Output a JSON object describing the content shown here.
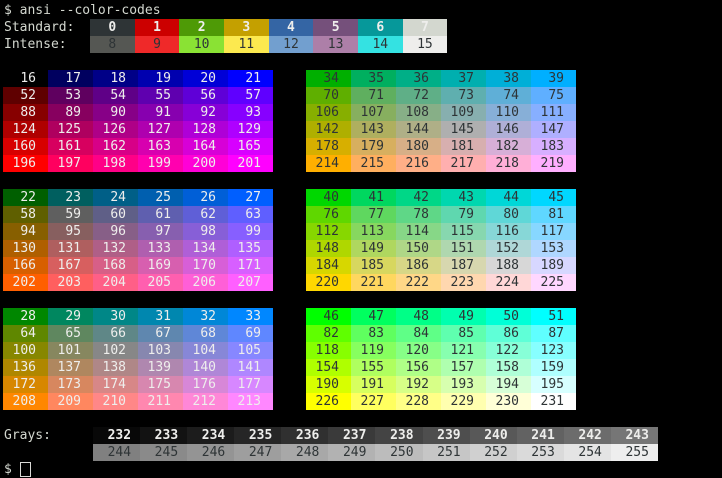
{
  "terminal": {
    "bg": "#000000",
    "fg": "#d3d7cf",
    "command_line": "$ ansi --color-codes",
    "prompt": "$",
    "cursor_color": "#d9d9d6",
    "cursor_style": "hollow-block"
  },
  "standard": {
    "label": "Standard:",
    "fg": "#eeeeec",
    "cells": [
      {
        "n": "0",
        "bg": "#2e3436"
      },
      {
        "n": "1",
        "bg": "#cc0000"
      },
      {
        "n": "2",
        "bg": "#4e9a06"
      },
      {
        "n": "3",
        "bg": "#c4a000"
      },
      {
        "n": "4",
        "bg": "#3465a4"
      },
      {
        "n": "5",
        "bg": "#75507b"
      },
      {
        "n": "6",
        "bg": "#06989a"
      },
      {
        "n": "7",
        "bg": "#d3d7cf"
      }
    ]
  },
  "intense": {
    "label": "Intense:",
    "fg": "#2e3436",
    "cells": [
      {
        "n": "8",
        "bg": "#555753"
      },
      {
        "n": "9",
        "bg": "#ef2929"
      },
      {
        "n": "10",
        "bg": "#8ae234"
      },
      {
        "n": "11",
        "bg": "#fce94f"
      },
      {
        "n": "12",
        "bg": "#729fcf"
      },
      {
        "n": "13",
        "bg": "#ad7fa8"
      },
      {
        "n": "14",
        "bg": "#34e2e2"
      },
      {
        "n": "15",
        "bg": "#eeeeec"
      }
    ]
  },
  "cube": {
    "blocks": [
      {
        "id": "block-l1",
        "name": "color-cube-block-1-left",
        "fg": "#eeeeec",
        "rows": [
          {
            "numbers": [
              "16",
              "17",
              "18",
              "19",
              "20",
              "21"
            ],
            "colors": [
              "#000000",
              "#00005f",
              "#000087",
              "#0000af",
              "#0000d7",
              "#0000ff"
            ]
          },
          {
            "numbers": [
              "52",
              "53",
              "54",
              "55",
              "56",
              "57"
            ],
            "colors": [
              "#5f0000",
              "#5f005f",
              "#5f0087",
              "#5f00af",
              "#5f00d7",
              "#5f00ff"
            ]
          },
          {
            "numbers": [
              "88",
              "89",
              "90",
              "91",
              "92",
              "93"
            ],
            "colors": [
              "#870000",
              "#87005f",
              "#870087",
              "#8700af",
              "#8700d7",
              "#8700ff"
            ]
          },
          {
            "numbers": [
              "124",
              "125",
              "126",
              "127",
              "128",
              "129"
            ],
            "colors": [
              "#af0000",
              "#af005f",
              "#af0087",
              "#af00af",
              "#af00d7",
              "#af00ff"
            ]
          },
          {
            "numbers": [
              "160",
              "161",
              "162",
              "163",
              "164",
              "165"
            ],
            "colors": [
              "#d70000",
              "#d7005f",
              "#d70087",
              "#d700af",
              "#d700d7",
              "#d700ff"
            ]
          },
          {
            "numbers": [
              "196",
              "197",
              "198",
              "199",
              "200",
              "201"
            ],
            "colors": [
              "#ff0000",
              "#ff005f",
              "#ff0087",
              "#ff00af",
              "#ff00d7",
              "#ff00ff"
            ]
          }
        ]
      },
      {
        "id": "block-r1",
        "name": "color-cube-block-1-right",
        "fg": "#2e3436",
        "rows": [
          {
            "numbers": [
              "34",
              "35",
              "36",
              "37",
              "38",
              "39"
            ],
            "colors": [
              "#00af00",
              "#00af5f",
              "#00af87",
              "#00afaf",
              "#00afd7",
              "#00afff"
            ]
          },
          {
            "numbers": [
              "70",
              "71",
              "72",
              "73",
              "74",
              "75"
            ],
            "colors": [
              "#5faf00",
              "#5faf5f",
              "#5faf87",
              "#5fafaf",
              "#5fafd7",
              "#5fafff"
            ]
          },
          {
            "numbers": [
              "106",
              "107",
              "108",
              "109",
              "110",
              "111"
            ],
            "colors": [
              "#87af00",
              "#87af5f",
              "#87af87",
              "#87afaf",
              "#87afd7",
              "#87afff"
            ]
          },
          {
            "numbers": [
              "142",
              "143",
              "144",
              "145",
              "146",
              "147"
            ],
            "colors": [
              "#afaf00",
              "#afaf5f",
              "#afaf87",
              "#afafaf",
              "#afafd7",
              "#afafff"
            ]
          },
          {
            "numbers": [
              "178",
              "179",
              "180",
              "181",
              "182",
              "183"
            ],
            "colors": [
              "#d7af00",
              "#d7af5f",
              "#d7af87",
              "#d7afaf",
              "#d7afd7",
              "#d7afff"
            ]
          },
          {
            "numbers": [
              "214",
              "215",
              "216",
              "217",
              "218",
              "219"
            ],
            "colors": [
              "#ffaf00",
              "#ffaf5f",
              "#ffaf87",
              "#ffafaf",
              "#ffafd7",
              "#ffafff"
            ]
          }
        ]
      },
      {
        "id": "block-l2",
        "name": "color-cube-block-2-left",
        "fg": "#eeeeec",
        "rows": [
          {
            "numbers": [
              "22",
              "23",
              "24",
              "25",
              "26",
              "27"
            ],
            "colors": [
              "#005f00",
              "#005f5f",
              "#005f87",
              "#005faf",
              "#005fd7",
              "#005fff"
            ]
          },
          {
            "numbers": [
              "58",
              "59",
              "60",
              "61",
              "62",
              "63"
            ],
            "colors": [
              "#5f5f00",
              "#5f5f5f",
              "#5f5f87",
              "#5f5faf",
              "#5f5fd7",
              "#5f5fff"
            ]
          },
          {
            "numbers": [
              "94",
              "95",
              "96",
              "97",
              "98",
              "99"
            ],
            "colors": [
              "#875f00",
              "#875f5f",
              "#875f87",
              "#875faf",
              "#875fd7",
              "#875fff"
            ]
          },
          {
            "numbers": [
              "130",
              "131",
              "132",
              "133",
              "134",
              "135"
            ],
            "colors": [
              "#af5f00",
              "#af5f5f",
              "#af5f87",
              "#af5faf",
              "#af5fd7",
              "#af5fff"
            ]
          },
          {
            "numbers": [
              "166",
              "167",
              "168",
              "169",
              "170",
              "171"
            ],
            "colors": [
              "#d75f00",
              "#d75f5f",
              "#d75f87",
              "#d75faf",
              "#d75fd7",
              "#d75fff"
            ]
          },
          {
            "numbers": [
              "202",
              "203",
              "204",
              "205",
              "206",
              "207"
            ],
            "colors": [
              "#ff5f00",
              "#ff5f5f",
              "#ff5f87",
              "#ff5faf",
              "#ff5fd7",
              "#ff5fff"
            ]
          }
        ]
      },
      {
        "id": "block-r2",
        "name": "color-cube-block-2-right",
        "fg": "#2e3436",
        "rows": [
          {
            "numbers": [
              "40",
              "41",
              "42",
              "43",
              "44",
              "45"
            ],
            "colors": [
              "#00d700",
              "#00d75f",
              "#00d787",
              "#00d7af",
              "#00d7d7",
              "#00d7ff"
            ]
          },
          {
            "numbers": [
              "76",
              "77",
              "78",
              "79",
              "80",
              "81"
            ],
            "colors": [
              "#5fd700",
              "#5fd75f",
              "#5fd787",
              "#5fd7af",
              "#5fd7d7",
              "#5fd7ff"
            ]
          },
          {
            "numbers": [
              "112",
              "113",
              "114",
              "115",
              "116",
              "117"
            ],
            "colors": [
              "#87d700",
              "#87d75f",
              "#87d787",
              "#87d7af",
              "#87d7d7",
              "#87d7ff"
            ]
          },
          {
            "numbers": [
              "148",
              "149",
              "150",
              "151",
              "152",
              "153"
            ],
            "colors": [
              "#afd700",
              "#afd75f",
              "#afd787",
              "#afd7af",
              "#afd7d7",
              "#afd7ff"
            ]
          },
          {
            "numbers": [
              "184",
              "185",
              "186",
              "187",
              "188",
              "189"
            ],
            "colors": [
              "#d7d700",
              "#d7d75f",
              "#d7d787",
              "#d7d7af",
              "#d7d7d7",
              "#d7d7ff"
            ]
          },
          {
            "numbers": [
              "220",
              "221",
              "222",
              "223",
              "224",
              "225"
            ],
            "colors": [
              "#ffd700",
              "#ffd75f",
              "#ffd787",
              "#ffd7af",
              "#ffd7d7",
              "#ffd7ff"
            ]
          }
        ]
      },
      {
        "id": "block-l3",
        "name": "color-cube-block-3-left",
        "fg": "#eeeeec",
        "rows": [
          {
            "numbers": [
              "28",
              "29",
              "30",
              "31",
              "32",
              "33"
            ],
            "colors": [
              "#008700",
              "#00875f",
              "#008787",
              "#0087af",
              "#0087d7",
              "#0087ff"
            ]
          },
          {
            "numbers": [
              "64",
              "65",
              "66",
              "67",
              "68",
              "69"
            ],
            "colors": [
              "#5f8700",
              "#5f875f",
              "#5f8787",
              "#5f87af",
              "#5f87d7",
              "#5f87ff"
            ]
          },
          {
            "numbers": [
              "100",
              "101",
              "102",
              "103",
              "104",
              "105"
            ],
            "colors": [
              "#878700",
              "#87875f",
              "#878787",
              "#8787af",
              "#8787d7",
              "#8787ff"
            ]
          },
          {
            "numbers": [
              "136",
              "137",
              "138",
              "139",
              "140",
              "141"
            ],
            "colors": [
              "#af8700",
              "#af875f",
              "#af8787",
              "#af87af",
              "#af87d7",
              "#af87ff"
            ]
          },
          {
            "numbers": [
              "172",
              "173",
              "174",
              "175",
              "176",
              "177"
            ],
            "colors": [
              "#d78700",
              "#d7875f",
              "#d78787",
              "#d787af",
              "#d787d7",
              "#d787ff"
            ]
          },
          {
            "numbers": [
              "208",
              "209",
              "210",
              "211",
              "212",
              "213"
            ],
            "colors": [
              "#ff8700",
              "#ff875f",
              "#ff8787",
              "#ff87af",
              "#ff87d7",
              "#ff87ff"
            ]
          }
        ]
      },
      {
        "id": "block-r3",
        "name": "color-cube-block-3-right",
        "fg": "#2e3436",
        "rows": [
          {
            "numbers": [
              "46",
              "47",
              "48",
              "49",
              "50",
              "51"
            ],
            "colors": [
              "#00ff00",
              "#00ff5f",
              "#00ff87",
              "#00ffaf",
              "#00ffd7",
              "#00ffff"
            ]
          },
          {
            "numbers": [
              "82",
              "83",
              "84",
              "85",
              "86",
              "87"
            ],
            "colors": [
              "#5fff00",
              "#5fff5f",
              "#5fff87",
              "#5fffaf",
              "#5fffd7",
              "#5fffff"
            ]
          },
          {
            "numbers": [
              "118",
              "119",
              "120",
              "121",
              "122",
              "123"
            ],
            "colors": [
              "#87ff00",
              "#87ff5f",
              "#87ff87",
              "#87ffaf",
              "#87ffd7",
              "#87ffff"
            ]
          },
          {
            "numbers": [
              "154",
              "155",
              "156",
              "157",
              "158",
              "159"
            ],
            "colors": [
              "#afff00",
              "#afff5f",
              "#afff87",
              "#afffaf",
              "#afffd7",
              "#afffff"
            ]
          },
          {
            "numbers": [
              "190",
              "191",
              "192",
              "193",
              "194",
              "195"
            ],
            "colors": [
              "#d7ff00",
              "#d7ff5f",
              "#d7ff87",
              "#d7ffaf",
              "#d7ffd7",
              "#d7ffff"
            ]
          },
          {
            "numbers": [
              "226",
              "227",
              "228",
              "229",
              "230",
              "231"
            ],
            "colors": [
              "#ffff00",
              "#ffff5f",
              "#ffff87",
              "#ffffaf",
              "#ffffd7",
              "#ffffff"
            ]
          }
        ]
      }
    ]
  },
  "grays": {
    "label": "Grays:",
    "rows": [
      {
        "fg": "#eeeeec",
        "bold": true,
        "numbers": [
          "232",
          "233",
          "234",
          "235",
          "236",
          "237",
          "238",
          "239",
          "240",
          "241",
          "242",
          "243"
        ],
        "colors": [
          "#080808",
          "#121212",
          "#1c1c1c",
          "#262626",
          "#303030",
          "#3a3a3a",
          "#444444",
          "#4e4e4e",
          "#585858",
          "#626262",
          "#6c6c6c",
          "#767676"
        ]
      },
      {
        "fg": "#2e3436",
        "bold": false,
        "numbers": [
          "244",
          "245",
          "246",
          "247",
          "248",
          "249",
          "250",
          "251",
          "252",
          "253",
          "254",
          "255"
        ],
        "colors": [
          "#808080",
          "#8a8a8a",
          "#949494",
          "#9e9e9e",
          "#a8a8a8",
          "#b2b2b2",
          "#bcbcbc",
          "#c6c6c6",
          "#d0d0d0",
          "#dadada",
          "#e4e4e4",
          "#eeeeee"
        ]
      }
    ]
  }
}
